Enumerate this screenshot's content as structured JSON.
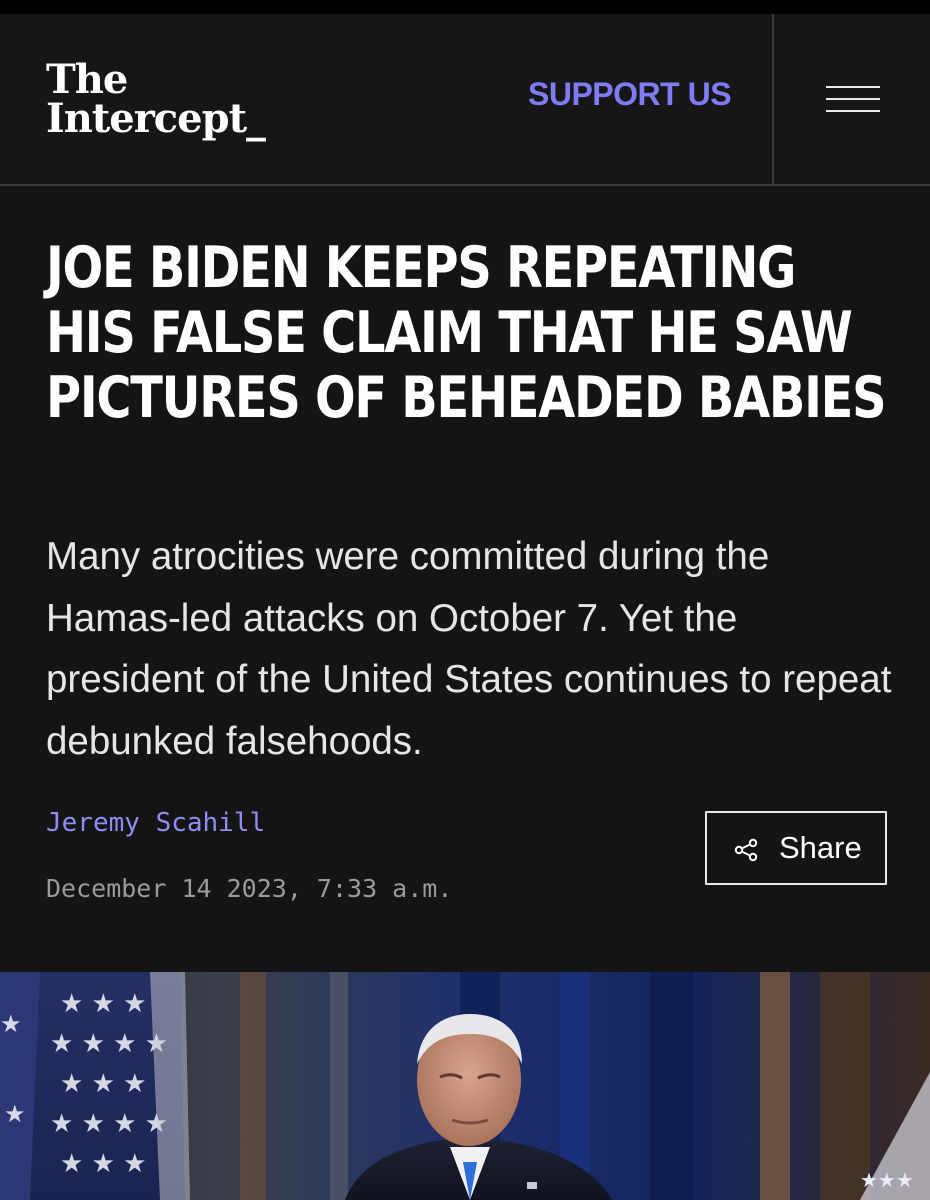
{
  "header": {
    "logo_line1": "The",
    "logo_line2": "Intercept_",
    "support_label": "SUPPORT US",
    "menu_icon": "hamburger-menu-icon"
  },
  "article": {
    "headline": "JOE BIDEN KEEPS REPEATING HIS FALSE CLAIM THAT HE SAW PICTURES OF BEHEADED BABIES",
    "dek": "Many atrocities were committed during the Hamas-led attacks on October 7. Yet the president of the United States continues to repeat debunked falsehoods.",
    "author": "Jeremy Scahill",
    "date": "December 14 2023, 7:33 a.m.",
    "share_label": "Share",
    "share_icon": "share-icon"
  },
  "colors": {
    "background": "#141414",
    "accent": "#7f7bf5",
    "text": "#ffffff"
  }
}
